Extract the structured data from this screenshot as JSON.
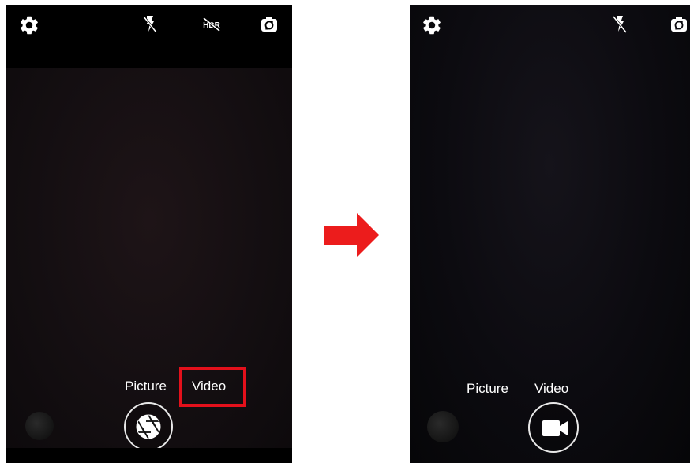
{
  "before": {
    "toolbar": {
      "settings_icon": "gear-icon",
      "flash_icon": "flash-off-icon",
      "hdr_icon": "hdr-off-icon",
      "switch_camera_icon": "camera-switch-icon"
    },
    "modes": {
      "picture_label": "Picture",
      "video_label": "Video",
      "highlighted": "Video"
    },
    "shutter_icon": "aperture-icon"
  },
  "after": {
    "toolbar": {
      "settings_icon": "gear-icon",
      "flash_icon": "flash-off-icon",
      "switch_camera_icon": "camera-switch-icon"
    },
    "modes": {
      "picture_label": "Picture",
      "video_label": "Video"
    },
    "shutter_icon": "video-camera-icon"
  },
  "colors": {
    "highlight": "#e3101b",
    "arrow": "#ec1c1c"
  }
}
